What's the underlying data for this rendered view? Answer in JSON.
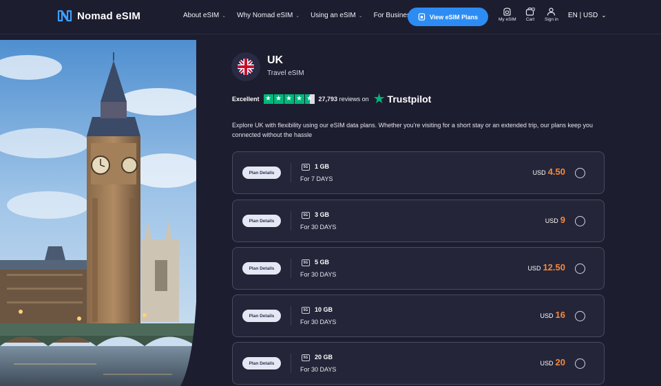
{
  "header": {
    "logo_text": "Nomad eSIM",
    "nav": [
      {
        "label": "About eSIM",
        "has_dropdown": true
      },
      {
        "label": "Why Nomad eSIM",
        "has_dropdown": true
      },
      {
        "label": "Using an eSIM",
        "has_dropdown": true
      },
      {
        "label": "For Business",
        "has_dropdown": false
      }
    ],
    "cta_label": "View eSIM Plans",
    "icons": [
      {
        "label": "My eSIM",
        "icon": "sim-icon"
      },
      {
        "label": "Cart",
        "icon": "cart-icon",
        "badge": "0"
      },
      {
        "label": "Sign in",
        "icon": "user-icon"
      }
    ],
    "locale": "EN | USD"
  },
  "product": {
    "country": "UK",
    "subtitle": "Travel eSIM",
    "flag_icon": "uk-flag-icon"
  },
  "rating": {
    "label": "Excellent",
    "stars": 4.5,
    "reviews_count": "27,793",
    "reviews_suffix": "reviews on",
    "provider": "Trustpilot"
  },
  "description": "Explore UK with flexibility using our eSIM data plans. Whether you're visiting for a short stay or an extended trip, our plans keep you connected without the hassle",
  "plans": [
    {
      "details_label": "Plan Details",
      "network": "5G",
      "data": "1 GB",
      "duration": "For 7 DAYS",
      "currency": "USD",
      "price": "4.50"
    },
    {
      "details_label": "Plan Details",
      "network": "5G",
      "data": "3 GB",
      "duration": "For 30 DAYS",
      "currency": "USD",
      "price": "9"
    },
    {
      "details_label": "Plan Details",
      "network": "5G",
      "data": "5 GB",
      "duration": "For 30 DAYS",
      "currency": "USD",
      "price": "12.50"
    },
    {
      "details_label": "Plan Details",
      "network": "5G",
      "data": "10 GB",
      "duration": "For 30 DAYS",
      "currency": "USD",
      "price": "16"
    },
    {
      "details_label": "Plan Details",
      "network": "5G",
      "data": "20 GB",
      "duration": "For 30 DAYS",
      "currency": "USD",
      "price": "20"
    }
  ],
  "colors": {
    "background": "#1d1d30",
    "accent_blue": "#2c8cf4",
    "price_orange": "#f6893b",
    "trustpilot_green": "#00b67a"
  }
}
